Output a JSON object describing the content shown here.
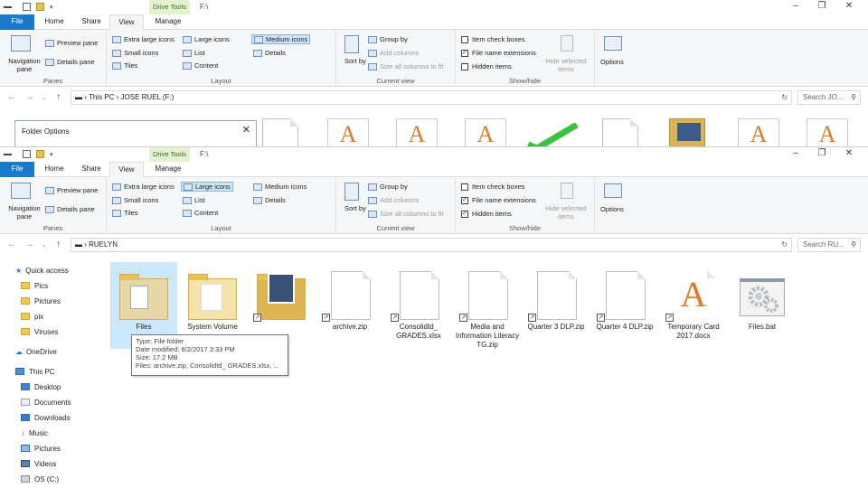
{
  "colors": {
    "accent": "#1979ca",
    "context_tab_bg": "#e5f2d0",
    "selection": "#cce8ff",
    "folder": "#f3d17c"
  },
  "back_window": {
    "context_tab": "Drive Tools",
    "title": "F:\\",
    "tabs": {
      "file": "File",
      "home": "Home",
      "share": "Share",
      "view": "View",
      "manage": "Manage"
    },
    "ribbon": {
      "panes": {
        "nav": "Navigation pane",
        "preview": "Preview pane",
        "details": "Details pane",
        "group": "Panes"
      },
      "layout": {
        "xl": "Extra large icons",
        "large": "Large icons",
        "medium": "Medium icons",
        "small": "Small icons",
        "list": "List",
        "details": "Details",
        "tiles": "Tiles",
        "content": "Content",
        "group": "Layout"
      },
      "current": {
        "sort": "Sort by",
        "group_by": "Group by",
        "add_cols": "Add columns",
        "size_cols": "Size all columns to fit",
        "group": "Current view"
      },
      "show": {
        "check": "Item check boxes",
        "ext": "File name extensions",
        "hidden": "Hidden items",
        "hide_sel": "Hide selected items",
        "group": "Show/hide"
      },
      "options": "Options"
    },
    "breadcrumb": [
      "This PC",
      "JOSE RUEL (F:)"
    ],
    "search_placeholder": "Search JO..."
  },
  "dialog": {
    "title": "Folder Options",
    "close": "✕"
  },
  "front_window": {
    "context_tab": "Drive Tools",
    "title": "F:\\",
    "tabs": {
      "file": "File",
      "home": "Home",
      "share": "Share",
      "view": "View",
      "manage": "Manage"
    },
    "ribbon": {
      "panes": {
        "nav": "Navigation pane",
        "preview": "Preview pane",
        "details": "Details pane",
        "group": "Panes"
      },
      "layout": {
        "xl": "Extra large icons",
        "large": "Large icons",
        "medium": "Medium icons",
        "small": "Small icons",
        "list": "List",
        "details": "Details",
        "tiles": "Tiles",
        "content": "Content",
        "group": "Layout"
      },
      "current": {
        "sort": "Sort by",
        "group_by": "Group by",
        "add_cols": "Add columns",
        "size_cols": "Size all columns to fit",
        "group": "Current view"
      },
      "show": {
        "check": "Item check boxes",
        "ext": "File name extensions",
        "hidden": "Hidden items",
        "hide_sel": "Hide selected items",
        "group": "Show/hide"
      },
      "options": "Options"
    },
    "breadcrumb": [
      "RUELYN"
    ],
    "search_placeholder": "Search RU...",
    "nav": [
      {
        "label": "Quick access"
      },
      {
        "label": "Pics"
      },
      {
        "label": "Pictures"
      },
      {
        "label": "pix"
      },
      {
        "label": "Viruses"
      },
      {
        "label": "OneDrive"
      },
      {
        "label": "This PC"
      },
      {
        "label": "Desktop"
      },
      {
        "label": "Documents"
      },
      {
        "label": "Downloads"
      },
      {
        "label": "Music"
      },
      {
        "label": "Pictures"
      },
      {
        "label": "Videos"
      },
      {
        "label": "OS (C:)"
      }
    ],
    "files": [
      {
        "name": "Files"
      },
      {
        "name": "System Volume"
      },
      {
        "name": ""
      },
      {
        "name": "archive.zip"
      },
      {
        "name": "Consolidtd_ GRADES.xlsx"
      },
      {
        "name": "Media and Information Literacy TG.zip"
      },
      {
        "name": "Quarter 3 DLP.zip"
      },
      {
        "name": "Quarter 4 DLP.zip"
      },
      {
        "name": "Temporary Card 2017.docx"
      },
      {
        "name": "Files.bat"
      }
    ],
    "tooltip": {
      "type": "Type: File folder",
      "modified": "Date modified: 8/2/2017 3:33 PM",
      "size": "Size: 17.2 MB",
      "files": "Files: archive.zip, Consolidtd_ GRADES.xlsx, ..."
    }
  }
}
